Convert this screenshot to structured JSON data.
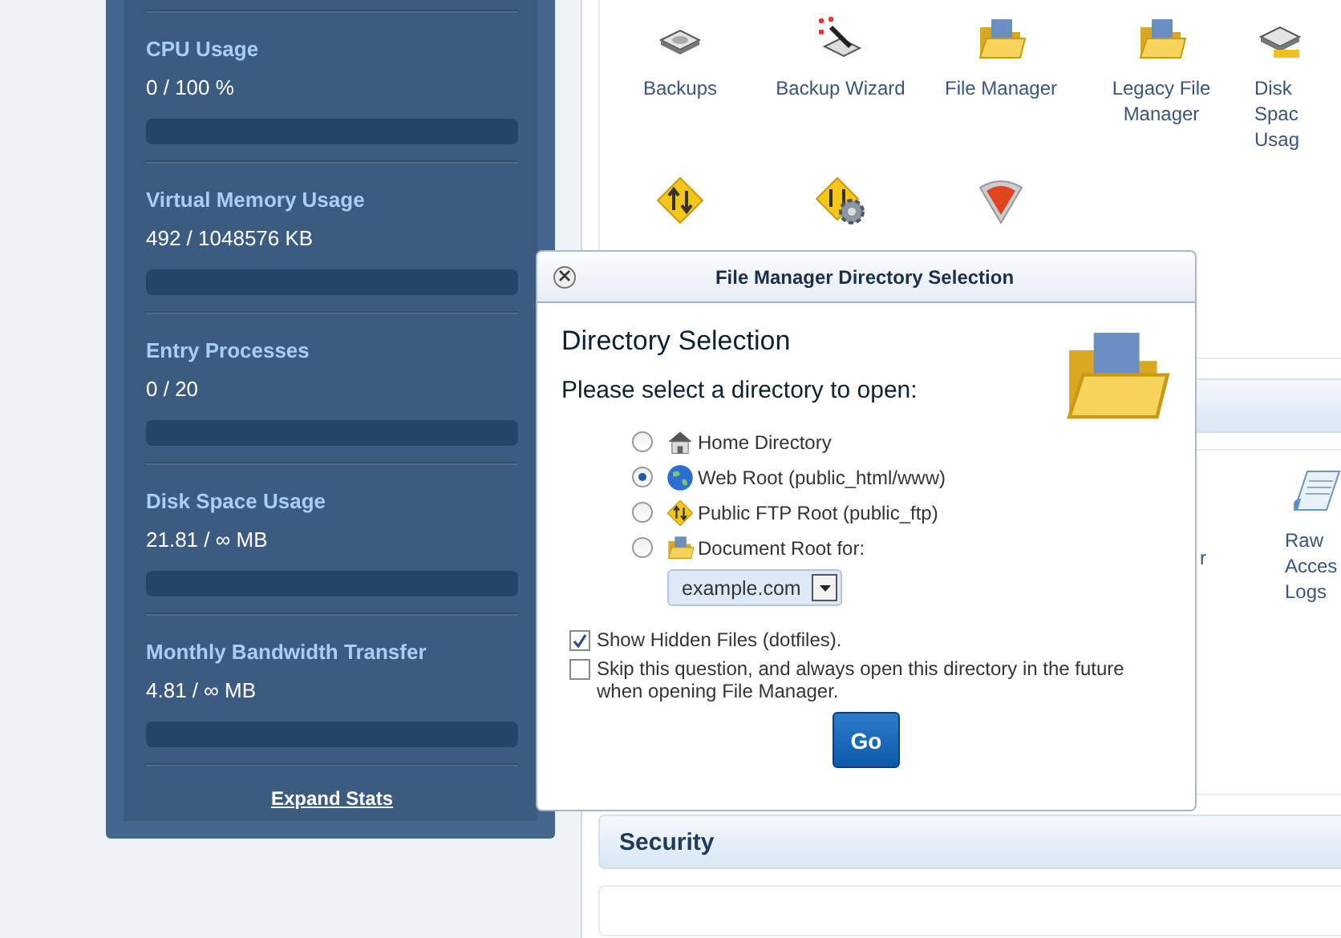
{
  "sidebar": {
    "stats": [
      {
        "label": "CPU Usage",
        "value": "0 / 100 %",
        "level": 0
      },
      {
        "label": "Virtual Memory Usage",
        "value": "492 / 1048576 KB",
        "level": 0
      },
      {
        "label": "Entry Processes",
        "value": "0 / 20",
        "level": 0
      },
      {
        "label": "Disk Space Usage",
        "value": "21.81 / ∞ MB",
        "level": 0
      },
      {
        "label": "Monthly Bandwidth Transfer",
        "value": "4.81 / ∞ MB",
        "level": 0
      }
    ],
    "expand_link": "Expand Stats"
  },
  "files_section": {
    "items": [
      {
        "label": "Backups",
        "kind": "disk"
      },
      {
        "label": "Backup Wizard",
        "kind": "wand"
      },
      {
        "label": "File Manager",
        "kind": "folder"
      },
      {
        "label": "Legacy File Manager",
        "kind": "folder"
      },
      {
        "label": "Disk Spac Usag",
        "kind": "diskbar"
      },
      {
        "kind": "ftp"
      },
      {
        "kind": "ftpgear"
      },
      {
        "kind": "shield"
      }
    ]
  },
  "logs_section": {
    "items": [
      {
        "label": "r",
        "kind": "hidden"
      },
      {
        "label": "Raw Acces Logs",
        "kind": "doc"
      }
    ]
  },
  "security_section": {
    "title": "Security"
  },
  "dialog": {
    "title": "File Manager Directory Selection",
    "heading": "Directory Selection",
    "prompt": "Please select a directory to open:",
    "options": [
      {
        "label": "Home Directory",
        "kind": "house",
        "selected": false
      },
      {
        "label": "Web Root (public_html/www)",
        "kind": "globe",
        "selected": true
      },
      {
        "label": "Public FTP Root (public_ftp)",
        "kind": "ftp",
        "selected": false
      },
      {
        "label": "Document Root for:",
        "kind": "folder",
        "selected": false
      }
    ],
    "domain_select": {
      "value": "example.com"
    },
    "checkboxes": [
      {
        "label": "Show Hidden Files (dotfiles).",
        "checked": true
      },
      {
        "label": "Skip this question, and always open this directory in the future when opening File Manager.",
        "checked": false
      }
    ],
    "button": "Go"
  }
}
